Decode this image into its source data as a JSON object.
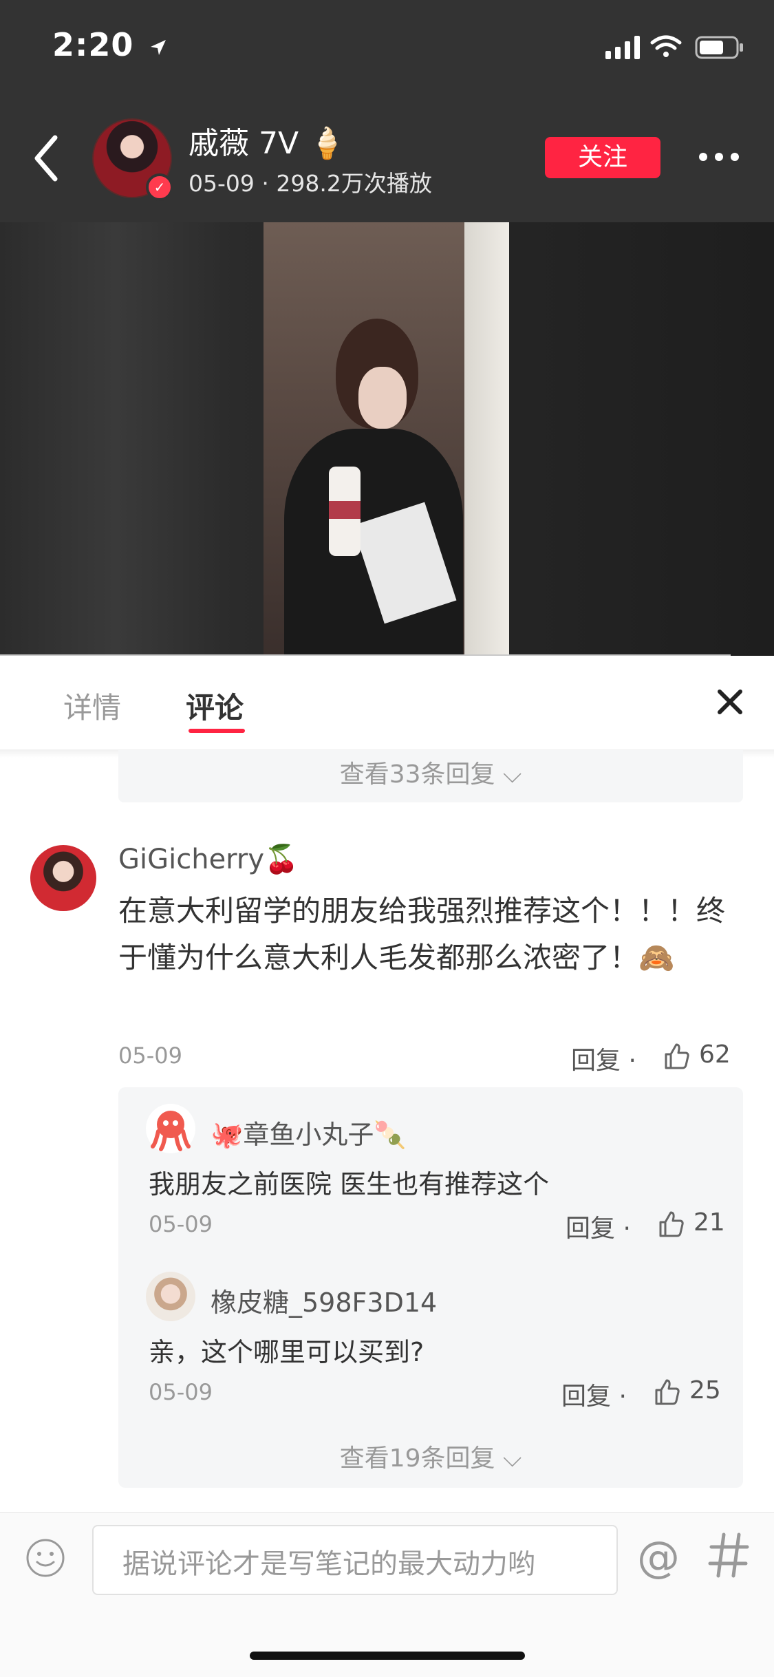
{
  "status": {
    "time": "2:20"
  },
  "header": {
    "username": "戚薇 7V",
    "user_emoji": "🍦",
    "meta": "05-09 · 298.2万次播放",
    "follow_label": "关注"
  },
  "tabs": {
    "detail": "详情",
    "comment": "评论"
  },
  "top_replies": {
    "view_more": "查看33条回复 ⌵"
  },
  "comment": {
    "username": "GiGicherry",
    "username_emoji": "🍒",
    "text": "在意大利留学的朋友给我强烈推荐这个！！！终于懂为什么意大利人毛发都那么浓密了！",
    "inline_emoji": "🙈",
    "date": "05-09",
    "reply_label": "回复 ·",
    "likes": "62"
  },
  "replies": [
    {
      "username": "🐙章鱼小丸子",
      "username_emoji": "🍡",
      "text": "我朋友之前医院 医生也有推荐这个",
      "date": "05-09",
      "reply_label": "回复 ·",
      "likes": "21"
    },
    {
      "username": "橡皮糖_598F3D14",
      "text": "亲，这个哪里可以买到?",
      "date": "05-09",
      "reply_label": "回复 ·",
      "likes": "25"
    }
  ],
  "nested_view_more": "查看19条回复 ⌵",
  "composer": {
    "placeholder": "据说评论才是写笔记的最大动力哟"
  },
  "colors": {
    "accent": "#ff2442",
    "topbar": "#333333",
    "panel": "#f5f6f7"
  },
  "icons": [
    "back-icon",
    "verified-icon",
    "more-icon",
    "close-icon",
    "like-icon",
    "emoji-icon",
    "at-icon",
    "hashtag-icon",
    "location-arrow-icon",
    "signal-icon",
    "wifi-icon",
    "battery-icon"
  ]
}
